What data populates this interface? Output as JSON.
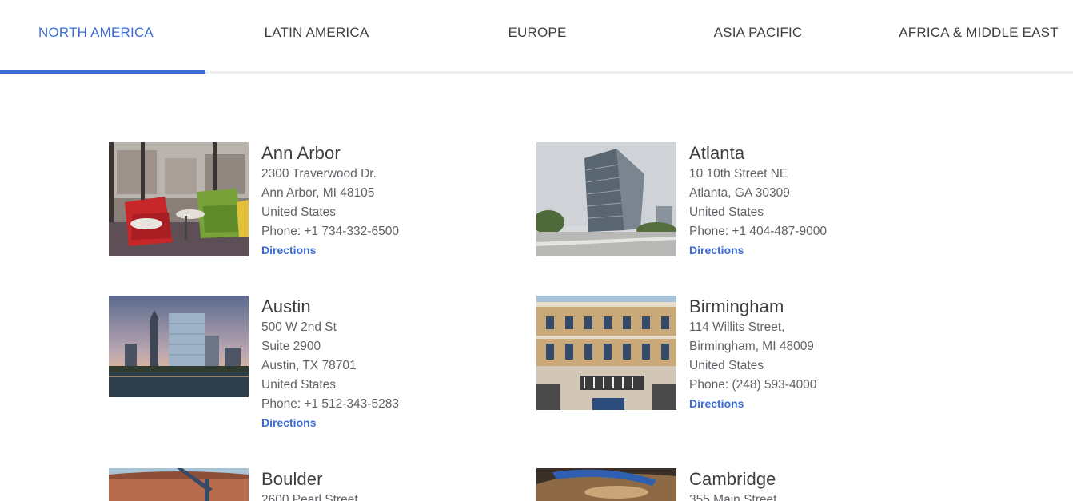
{
  "tabs": [
    {
      "label": "NORTH AMERICA",
      "active": true
    },
    {
      "label": "LATIN AMERICA",
      "active": false
    },
    {
      "label": "EUROPE",
      "active": false
    },
    {
      "label": "ASIA PACIFIC",
      "active": false
    },
    {
      "label": "AFRICA & MIDDLE EAST",
      "active": false
    }
  ],
  "accent_color": "#3b6cd4",
  "offices": [
    {
      "city": "Ann Arbor",
      "lines": [
        "2300 Traverwood Dr.",
        "Ann Arbor, MI 48105",
        "United States",
        "Phone: +1 734-332-6500"
      ],
      "directions": "Directions"
    },
    {
      "city": "Atlanta",
      "lines": [
        "10 10th Street NE",
        "Atlanta, GA 30309",
        "United States",
        "Phone: +1 404-487-9000"
      ],
      "directions": "Directions"
    },
    {
      "city": "Austin",
      "lines": [
        "500 W 2nd St",
        "Suite 2900",
        "Austin, TX 78701",
        "United States",
        "Phone: +1 512-343-5283"
      ],
      "directions": "Directions"
    },
    {
      "city": "Birmingham",
      "lines": [
        "114 Willits Street,",
        "Birmingham, MI 48009",
        "United States",
        "Phone: (248) 593-4000"
      ],
      "directions": "Directions"
    },
    {
      "city": "Boulder",
      "lines": [
        "2600 Pearl Street"
      ],
      "directions": ""
    },
    {
      "city": "Cambridge",
      "lines": [
        "355 Main Street"
      ],
      "directions": ""
    }
  ]
}
